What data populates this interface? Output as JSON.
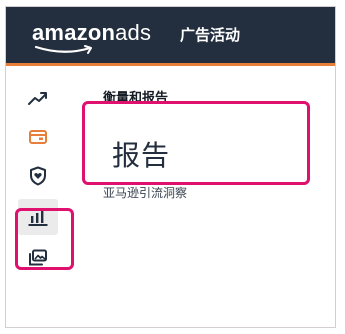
{
  "header": {
    "logo_part1": "amazon",
    "logo_part2": "ads",
    "nav_title": "广告活动"
  },
  "sidebar": {
    "items": [
      {
        "name": "trending-icon"
      },
      {
        "name": "wallet-icon"
      },
      {
        "name": "shield-heart-icon"
      },
      {
        "name": "bar-chart-icon",
        "selected": true
      },
      {
        "name": "image-gallery-icon"
      }
    ]
  },
  "menu": {
    "section_title": "衡量和报告",
    "highlighted_item": "报告",
    "description": "亚马逊引流洞察"
  },
  "colors": {
    "topbar": "#232f3e",
    "accent_orange": "#e77f3a",
    "highlight": "#e0106f"
  }
}
